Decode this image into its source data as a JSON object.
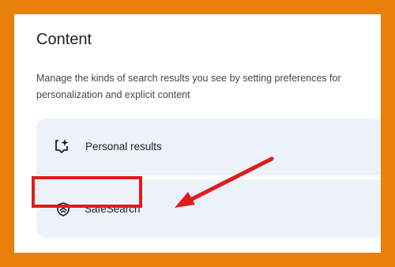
{
  "content": {
    "title": "Content",
    "description_line1": "Manage the kinds of search results you see by setting preferences for",
    "description_line2": "personalization and explicit content"
  },
  "rows": {
    "personal_results": {
      "label": "Personal results",
      "icon": "sparkle-comment-icon"
    },
    "safesearch": {
      "label": "SafeSearch",
      "icon": "shield-icon"
    }
  },
  "annotation": {
    "color": "#e01b1b",
    "target": "safesearch"
  },
  "colors": {
    "frame": "#e8800a",
    "row_background": "#edf2fa",
    "panel": "#ffffff"
  }
}
